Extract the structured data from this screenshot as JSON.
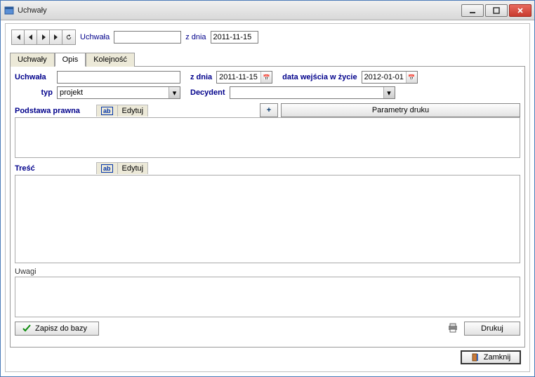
{
  "window": {
    "title": "Uchwały"
  },
  "toolbar": {
    "uchwala_label": "Uchwała",
    "uchwala_value": "",
    "z_dnia_label": "z dnia",
    "z_dnia_value": "2011-11-15"
  },
  "tabs": {
    "t1": "Uchwały",
    "t2": "Opis",
    "t3": "Kolejność",
    "active": "Opis"
  },
  "form": {
    "uchwala_label": "Uchwała",
    "uchwala_value": "",
    "z_dnia_label": "z dnia",
    "z_dnia_value": "2011-11-15",
    "data_wejscia_label": "data wejścia w życie",
    "data_wejscia_value": "2012-01-01",
    "typ_label": "typ",
    "typ_value": "projekt",
    "decydent_label": "Decydent",
    "decydent_value": "",
    "plus_label": "+",
    "parametry_label": "Parametry druku"
  },
  "sections": {
    "podstawa_label": "Podstawa prawna",
    "tresc_label": "Treść",
    "uwagi_label": "Uwagi",
    "edytuj_label": "Edytuj"
  },
  "buttons": {
    "zapisz": "Zapisz do bazy",
    "drukuj": "Drukuj",
    "zamknij": "Zamknij"
  }
}
